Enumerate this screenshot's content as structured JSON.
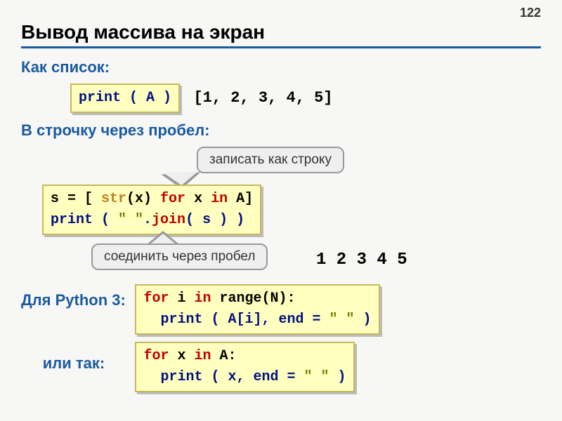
{
  "page_number": "122",
  "title": "Вывод массива на экран",
  "section1": {
    "label": "Как список:",
    "code": "print ( A )",
    "output": "[1, 2, 3, 4, 5]"
  },
  "section2": {
    "label": "В строчку через пробел:",
    "callout1": "записать как строку",
    "code_line1_a": "s = [ ",
    "code_line1_str": "str",
    "code_line1_b": "(x) ",
    "code_line1_for": "for",
    "code_line1_c": " x ",
    "code_line1_in": "in",
    "code_line1_d": " A]",
    "code_line2_a": "print ( ",
    "code_line2_lit": "\" \"",
    "code_line2_b": ".",
    "code_line2_join": "join",
    "code_line2_c": "( s ) )",
    "callout2": "соединить через пробел",
    "output": "1 2 3 4 5"
  },
  "section3": {
    "label": "Для Python 3:",
    "code_line1_for": "for",
    "code_line1_a": " i ",
    "code_line1_in": "in",
    "code_line1_b": " range(N):",
    "code_line2_a": "print ( A[i], end = ",
    "code_line2_lit": "\" \"",
    "code_line2_b": " )"
  },
  "section4": {
    "label": "или так:",
    "code_line1_for": "for",
    "code_line1_a": " x ",
    "code_line1_in": "in",
    "code_line1_b": " A:",
    "code_line2_a": "print ( x, end = ",
    "code_line2_lit": "\" \"",
    "code_line2_b": " )"
  }
}
